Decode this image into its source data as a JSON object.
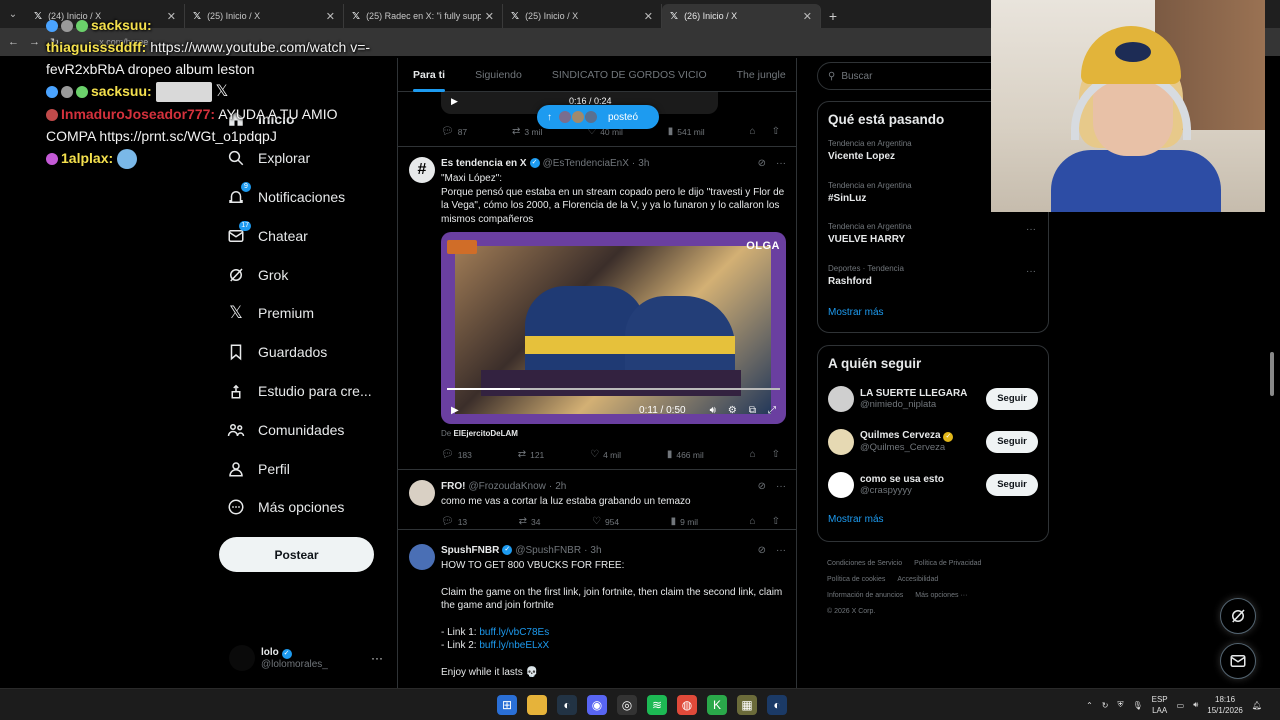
{
  "browser": {
    "tabs": [
      {
        "title": "(24) Inicio / X",
        "active": false
      },
      {
        "title": "(25) Inicio / X",
        "active": false
      },
      {
        "title": "(25) Radec en X: \"i fully suppor",
        "active": false
      },
      {
        "title": "(25) Inicio / X",
        "active": false
      },
      {
        "title": "(26) Inicio / X",
        "active": true
      }
    ],
    "new_tab": "+",
    "url": "x.com/home"
  },
  "chat": [
    {
      "user": "sacksuu:",
      "user_color": "#f4e04d",
      "text": ""
    },
    {
      "user": "thiaguisssddff:",
      "user_color": "#f4e04d",
      "text": "https://www.youtube.com/watch v=-fevR2xbRbA dropeo album leston"
    },
    {
      "user": "sacksuu:",
      "user_color": "#f4e04d",
      "text": ""
    },
    {
      "user": "InmaduroJoseador777:",
      "user_color": "#d4313c",
      "text": "AYUDA A TU AMIO COMPA https://prnt.sc/WGt_o1pdqpJ"
    },
    {
      "user": "1alplax:",
      "user_color": "#f4e04d",
      "text": ""
    }
  ],
  "nav": {
    "items": [
      {
        "label": "Inicio",
        "icon": "home-icon",
        "badge": ""
      },
      {
        "label": "Explorar",
        "icon": "search-icon",
        "badge": ""
      },
      {
        "label": "Notificaciones",
        "icon": "bell-icon",
        "badge": "9"
      },
      {
        "label": "Chatear",
        "icon": "mail-icon",
        "badge": "17"
      },
      {
        "label": "Grok",
        "icon": "grok-icon",
        "badge": ""
      },
      {
        "label": "Premium",
        "icon": "x-logo-icon",
        "badge": ""
      },
      {
        "label": "Guardados",
        "icon": "bookmark-icon",
        "badge": ""
      },
      {
        "label": "Estudio para cre...",
        "icon": "studio-icon",
        "badge": ""
      },
      {
        "label": "Comunidades",
        "icon": "people-icon",
        "badge": ""
      },
      {
        "label": "Perfil",
        "icon": "person-icon",
        "badge": ""
      },
      {
        "label": "Más opciones",
        "icon": "more-circle-icon",
        "badge": ""
      }
    ],
    "post_label": "Postear",
    "account": {
      "name": "lolo",
      "handle": "@lolomorales_"
    }
  },
  "feed": {
    "tabs": [
      "Para ti",
      "Siguiendo",
      "SINDICATO DE GORDOS VICIO",
      "The jungle"
    ],
    "posted_pill": "posteó",
    "previous_post": {
      "video_time": "0:16 / 0:24",
      "stats": {
        "replies": "87",
        "reposts": "3 mil",
        "likes": "40 mil",
        "views": "541 mil"
      }
    },
    "posts": [
      {
        "name": "Es tendencia en X",
        "handle": "@EsTendenciaEnX",
        "time": "3h",
        "text": "\"Maxi López\":\nPorque pensó que estaba en un stream copado pero le dijo \"travesti y Flor de la Vega\", cómo los 2000, a Florencia de la V, y ya lo funaron y lo callaron los mismos compañeros",
        "video_time": "0:11 / 0:50",
        "video_progress": 0.22,
        "video_brand": "OLGA",
        "from_label": "De",
        "from_account": "ElEjercitoDeLAM",
        "stats": {
          "replies": "183",
          "reposts": "121",
          "likes": "4 mil",
          "views": "466 mil"
        }
      },
      {
        "name": "FRO!",
        "handle": "@FrozoudaKnow",
        "time": "2h",
        "text": "como me vas a cortar la luz estaba grabando un temazo",
        "stats": {
          "replies": "13",
          "reposts": "34",
          "likes": "954",
          "views": "9 mil"
        }
      },
      {
        "name": "SpushFNBR",
        "handle": "@SpushFNBR",
        "time": "3h",
        "text_1": "HOW TO GET 800 VBUCKS FOR FREE:",
        "text_2": "Claim the game on the first link, join fortnite, then claim the second link, claim the game and join fortnite",
        "link1_prefix": "- Link 1: ",
        "link1": "buff.ly/vbC78Es",
        "link2_prefix": "- Link 2: ",
        "link2": "buff.ly/nbeELxX",
        "text_3": "Enjoy while it lasts 💀"
      }
    ]
  },
  "right": {
    "search_placeholder": "Buscar",
    "trends_title": "Qué está pasando",
    "trends": [
      {
        "context": "Tendencia en Argentina",
        "topic": "Vicente Lopez"
      },
      {
        "context": "Tendencia en Argentina",
        "topic": "#SinLuz"
      },
      {
        "context": "Tendencia en Argentina",
        "topic": "VUELVE HARRY"
      },
      {
        "context": "Deportes · Tendencia",
        "topic": "Rashford"
      }
    ],
    "show_more": "Mostrar más",
    "follow_title": "A quién seguir",
    "follow": [
      {
        "name": "LA SUERTE LLEGARA",
        "handle": "@nimiedo_niplata",
        "verified": "",
        "color": "#cfcfcf"
      },
      {
        "name": "Quilmes Cerveza",
        "handle": "@Quilmes_Cerveza",
        "verified": "gold",
        "color": "#e6d9b3"
      },
      {
        "name": "como se usa esto",
        "handle": "@craspyyyy",
        "verified": "",
        "color": "#ffffff"
      }
    ],
    "follow_button": "Seguir",
    "footer": [
      "Condiciones de Servicio",
      "Política de Privacidad",
      "Política de cookies",
      "Accesibilidad",
      "Información de anuncios",
      "Más opciones ···",
      "© 2026 X Corp."
    ]
  },
  "taskbar": {
    "lang_1": "ESP",
    "lang_2": "LAA",
    "time": "18:16",
    "date": "15/1/2026"
  },
  "colors": {
    "accent": "#1d9bf0",
    "background": "#000000",
    "border": "#2f3336",
    "muted": "#71767b"
  }
}
